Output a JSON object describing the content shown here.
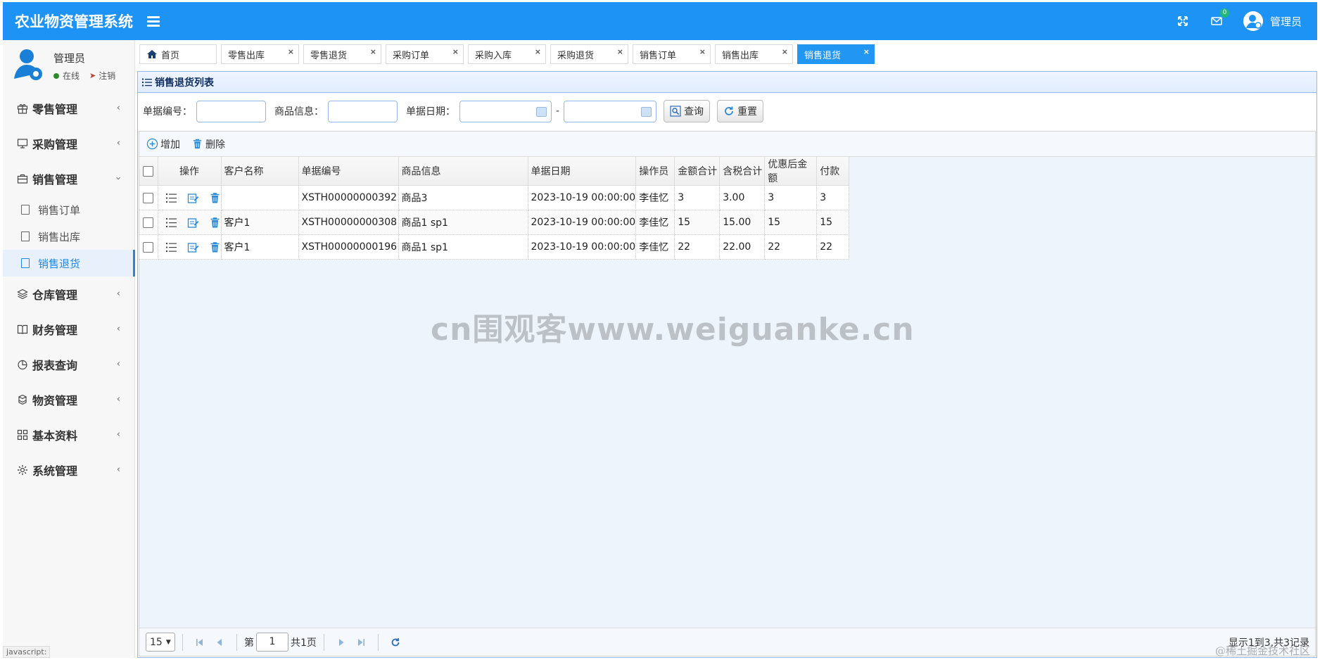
{
  "app": {
    "title": "农业物资管理系统"
  },
  "header": {
    "message_badge": "0",
    "user_name": "管理员"
  },
  "sidebar": {
    "user": {
      "name": "管理员",
      "status": "在线",
      "logout": "注销"
    },
    "menu": [
      {
        "label": "零售管理",
        "icon": "gift-icon"
      },
      {
        "label": "采购管理",
        "icon": "monitor-icon"
      },
      {
        "label": "销售管理",
        "icon": "briefcase-icon"
      },
      {
        "label": "仓库管理",
        "icon": "layers-icon"
      },
      {
        "label": "财务管理",
        "icon": "book-icon"
      },
      {
        "label": "报表查询",
        "icon": "pie-chart-icon"
      },
      {
        "label": "物资管理",
        "icon": "cubes-icon"
      },
      {
        "label": "基本资料",
        "icon": "grid-icon"
      },
      {
        "label": "系统管理",
        "icon": "gear-icon"
      }
    ],
    "sales_sub": [
      {
        "label": "销售订单"
      },
      {
        "label": "销售出库"
      },
      {
        "label": "销售退货"
      }
    ]
  },
  "tabs": [
    {
      "label": "首页"
    },
    {
      "label": "零售出库"
    },
    {
      "label": "零售退货"
    },
    {
      "label": "采购订单"
    },
    {
      "label": "采购入库"
    },
    {
      "label": "采购退货"
    },
    {
      "label": "销售订单"
    },
    {
      "label": "销售出库"
    },
    {
      "label": "销售退货"
    }
  ],
  "tab_close": "×",
  "panel": {
    "title": "销售退货列表"
  },
  "search": {
    "doc_no_label": "单据编号：",
    "goods_label": "商品信息：",
    "date_label": "单据日期：",
    "dash": "-",
    "query_btn": "查询",
    "reset_btn": "重置"
  },
  "toolbar": {
    "add": "增加",
    "delete": "删除"
  },
  "table": {
    "headers": [
      "操作",
      "客户名称",
      "单据编号",
      "商品信息",
      "单据日期",
      "操作员",
      "金额合计",
      "含税合计",
      "优惠后金额",
      "付款"
    ],
    "rows": [
      [
        "",
        "XSTH00000000392",
        "商品3",
        "2023-10-19 00:00:00",
        "李佳忆",
        "3",
        "3.00",
        "3",
        "3"
      ],
      [
        "客户1",
        "XSTH00000000308",
        "商品1 sp1",
        "2023-10-19 00:00:00",
        "李佳忆",
        "15",
        "15.00",
        "15",
        "15"
      ],
      [
        "客户1",
        "XSTH00000000196",
        "商品1 sp1",
        "2023-10-19 00:00:00",
        "李佳忆",
        "22",
        "22.00",
        "22",
        "22"
      ]
    ]
  },
  "pager": {
    "page_size": "15",
    "page_prefix": "第",
    "page_value": "1",
    "page_suffix": "共1页",
    "info": "显示1到3,共3记录"
  },
  "watermark": "cn围观客www.weiguanke.cn",
  "corner_note": "@稀土掘金技术社区",
  "status_bar": "javascript:",
  "colors": {
    "header": "#1e93f6",
    "active_tab": "#2196f3",
    "panel_border": "#95b8e7",
    "active_menu": "#1e88e5"
  }
}
